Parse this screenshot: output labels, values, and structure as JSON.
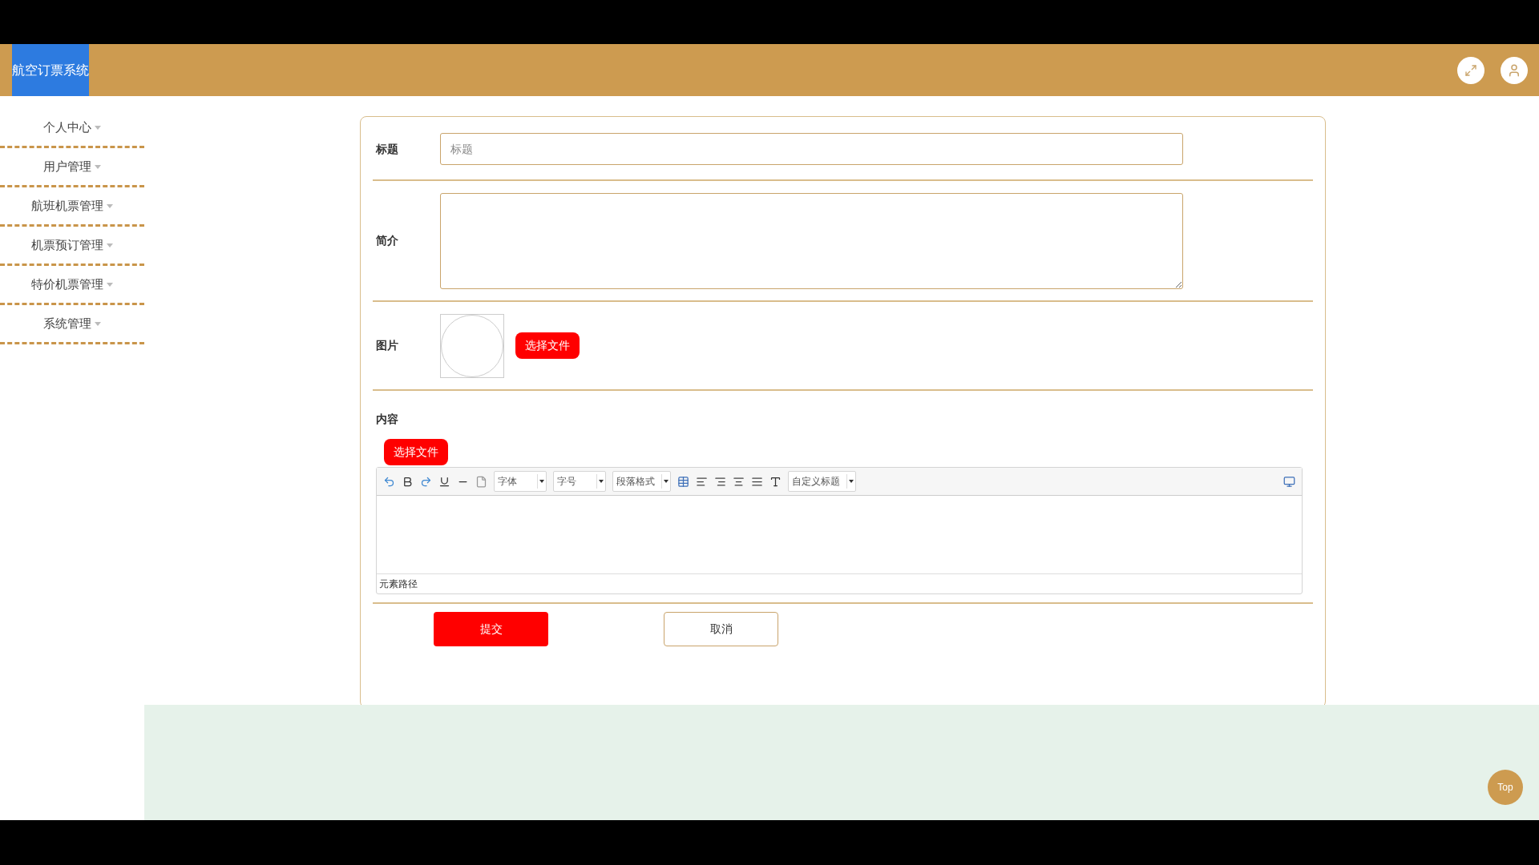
{
  "header": {
    "title": "航空订票系统"
  },
  "sidebar": {
    "items": [
      {
        "label": "个人中心"
      },
      {
        "label": "用户管理"
      },
      {
        "label": "航班机票管理"
      },
      {
        "label": "机票预订管理"
      },
      {
        "label": "特价机票管理"
      },
      {
        "label": "系统管理"
      }
    ]
  },
  "form": {
    "fields": [
      {
        "kind": "text",
        "label": "标题",
        "placeholder": "标题"
      },
      {
        "kind": "textarea",
        "label": "简介"
      },
      {
        "kind": "image",
        "label": "图片",
        "button": "选择文件"
      },
      {
        "kind": "editor",
        "label": "内容",
        "button": "选择文件",
        "status": "元素路径",
        "toolbar": [
          {
            "kind": "undo"
          },
          {
            "kind": "bold"
          },
          {
            "kind": "redo"
          },
          {
            "kind": "underline"
          },
          {
            "kind": "rule"
          },
          {
            "kind": "page"
          },
          {
            "kind": "select",
            "label": "字体"
          },
          {
            "kind": "select",
            "label": "字号"
          },
          {
            "kind": "select",
            "label": "段落格式"
          },
          {
            "kind": "table"
          },
          {
            "kind": "left"
          },
          {
            "kind": "right"
          },
          {
            "kind": "center"
          },
          {
            "kind": "justify"
          },
          {
            "kind": "color"
          },
          {
            "kind": "select",
            "label": "自定义标题"
          }
        ]
      }
    ],
    "actions": [
      {
        "kind": "primary",
        "label": "提交"
      },
      {
        "kind": "secondary",
        "label": "取消"
      }
    ]
  },
  "top_button": {
    "label": "Top"
  }
}
